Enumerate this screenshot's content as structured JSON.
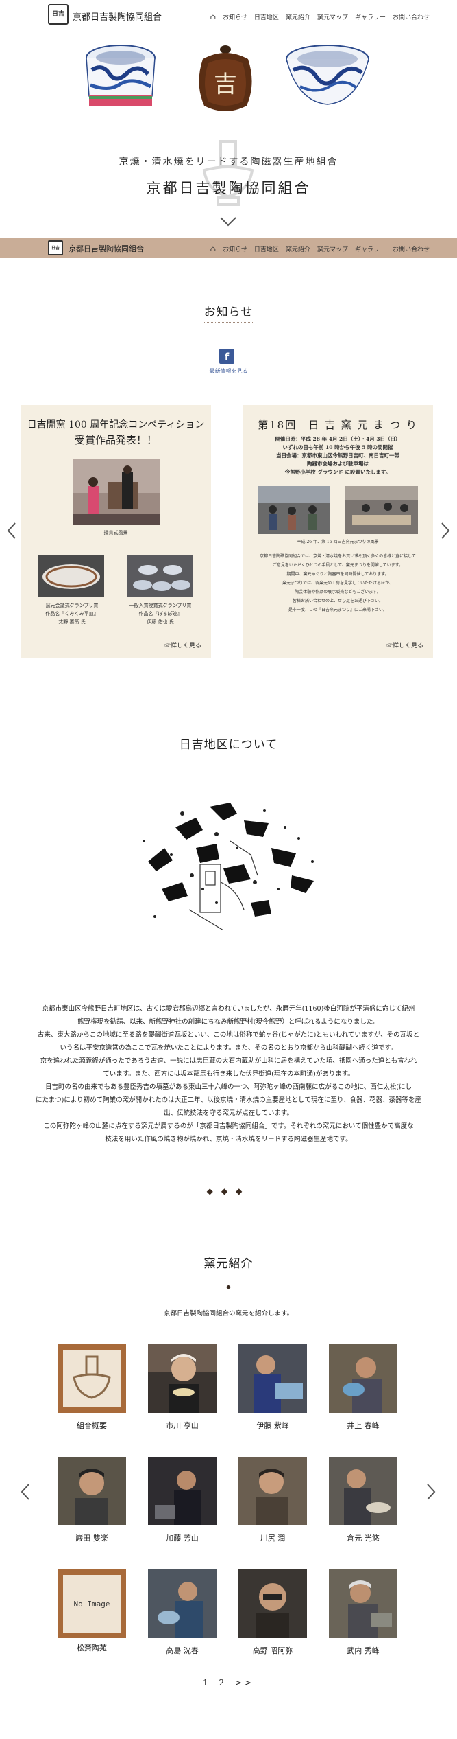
{
  "header": {
    "logo_text": "日吉",
    "org_name": "京都日吉製陶協同組合",
    "nav": [
      "お知らせ",
      "日吉地区",
      "窯元紹介",
      "窯元マップ",
      "ギャラリー",
      "お問い合わせ"
    ]
  },
  "hero": {
    "subtitle": "京焼・清水焼をリードする陶磁器生産地組合",
    "title": "京都日吉製陶協同組合"
  },
  "news": {
    "title": "お知らせ",
    "fb_icon": "f",
    "fb_link": "最新情報を見る",
    "card1": {
      "title1": "日吉開窯 100 周年記念コンペティション",
      "title2": "受賞作品発表！！",
      "photo_caption": "授賞式風景",
      "item1_caption": [
        "窯元会議式グランプリ賞",
        "作品名『くみくみ平皿』",
        "丈野 要策 氏"
      ],
      "item2_caption": [
        "一般入賞授賞式グランプリ賞",
        "作品名『ぽるぽ碗』",
        "伊藤 佑也 氏"
      ],
      "more": "☞詳しく見る"
    },
    "card2": {
      "title": "第18回　日 吉 窯 元 ま つ り",
      "info": [
        "開催日時：平成 28 年 4月 2日（土）・4月 3日（日）",
        "いずれの日も午前 10 時から午後 5 時の間開催",
        "当日会場：京都市東山区今熊野日吉町、南日吉町一帯",
        "陶器市会場および駐車場は",
        "今熊野小学校 グラウンド に設置いたします。"
      ],
      "photo_caption": "平成 26 年、第 16 回日吉窯元まつりの風景",
      "body": [
        "京都日吉陶磁協同組合では、京焼・清水焼をお買い求め頂く多くの皆様と直に接して",
        "ご意見をいただくひとつの手段として、窯元まつりを開催しています。",
        "期間中、窯元めぐりと陶器市を同時開催しております。",
        "窯元まつりでは、各窯元の工房を見学していただけるほか、",
        "陶芸体験や作品の展示販売などもございます。",
        "皆様お誘い合わせの上、ぜひ足をお運び下さい。",
        "是非一度、この『日吉窯元まつり』にご来場下さい。"
      ],
      "more": "☞詳しく見る"
    }
  },
  "about": {
    "title": "日吉地区について",
    "text": [
      "京都市東山区今熊野日吉町地区は、古くは愛宕郡鳥辺郷と言われていましたが、永暦元年(1160)後白河院が平清盛に命じて紀州",
      "熊野権現を勧請、以来、新熊野神社の創建にちなみ新熊野村(現今熊野）と呼ばれるようになりました。",
      "古来、東大路からこの地域に至る路を醍醐街道瓦坂といい、この地は俗称で蛇ヶ谷(じゃがたに)ともいわれていますが、その瓦坂と",
      "いう名は平安京造営の為ここで瓦を焼いたことによります。また、その名のとおり京都から山科醍醐へ続く道です。",
      "京を追われた源義経が通ったであろう古道、一説には忠臣蔵の大石内蔵助が山科に居を構えていた頃、祇園へ通った道とも言われ",
      "ています。また、西方には坂本龍馬も行き来した伏見街道(現在の本町通)があります。",
      "日吉町の名の由来でもある豊臣秀吉の墳墓がある東山三十六峰の一つ、阿弥陀ヶ峰の西南麓に広がるこの地に、西仁太松(にし",
      "にたまつ)により初めて陶業の窯が開かれたのは大正二年、以後京焼・清水焼の主要産地として現在に至り、食器、花器、茶器等を産",
      "出、伝統技法を守る窯元が点在しています。",
      "この阿弥陀ヶ峰の山麓に点在する窯元が属するのが「京都日吉製陶協同組合」です。それぞれの窯元において個性豊かで高度な",
      "技法を用いた作風の焼き物が焼かれ、京焼・清水焼をリードする陶磁器生産地です。"
    ],
    "diamonds": "◆◆◆"
  },
  "kilns": {
    "title": "窯元紹介",
    "diamond": "◆",
    "description": "京都日吉製陶協同組合の窯元を紹介します。",
    "no_image": "No Image",
    "items": [
      {
        "name": "組合概要"
      },
      {
        "name": "市川 亨山"
      },
      {
        "name": "伊藤 紫峰"
      },
      {
        "name": "井上 春峰"
      },
      {
        "name": "巌田 雙楽"
      },
      {
        "name": "加藤 芳山"
      },
      {
        "name": "川尻 潤"
      },
      {
        "name": "倉元 光悠"
      },
      {
        "name": "松斎陶苑"
      },
      {
        "name": "高島 洸春"
      },
      {
        "name": "高野 昭阿弥"
      },
      {
        "name": "武内 秀峰"
      }
    ],
    "pager": [
      "1",
      "2",
      ">>"
    ]
  },
  "colors": {
    "bar": "#c9ad97",
    "card_bg": "#f5efe2",
    "facebook": "#3b5998"
  }
}
